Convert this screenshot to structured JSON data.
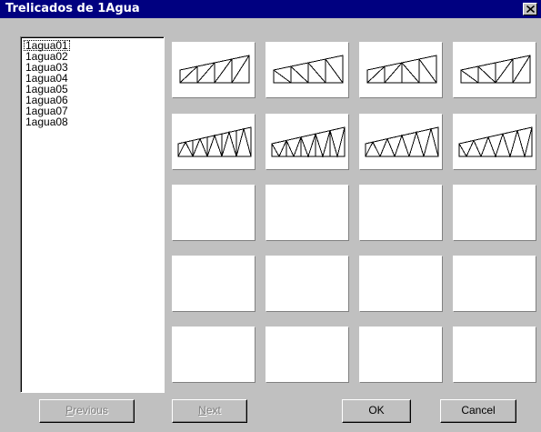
{
  "window": {
    "title": "Trelicados de 1Agua",
    "close_label": "×"
  },
  "list": {
    "items": [
      "1agua01",
      "1agua02",
      "1agua03",
      "1agua04",
      "1agua05",
      "1agua06",
      "1agua07",
      "1agua08"
    ],
    "focused_index": 0
  },
  "thumbnails": [
    {
      "row": 1,
      "col": 1,
      "item": "1agua01",
      "empty": false
    },
    {
      "row": 1,
      "col": 2,
      "item": "1agua02",
      "empty": false
    },
    {
      "row": 1,
      "col": 3,
      "item": "1agua03",
      "empty": false
    },
    {
      "row": 1,
      "col": 4,
      "item": "1agua04",
      "empty": false
    },
    {
      "row": 2,
      "col": 1,
      "item": "1agua05",
      "empty": false
    },
    {
      "row": 2,
      "col": 2,
      "item": "1agua06",
      "empty": false
    },
    {
      "row": 2,
      "col": 3,
      "item": "1agua07",
      "empty": false
    },
    {
      "row": 2,
      "col": 4,
      "item": "1agua08",
      "empty": false
    },
    {
      "row": 3,
      "col": 1,
      "empty": true
    },
    {
      "row": 3,
      "col": 2,
      "empty": true
    },
    {
      "row": 3,
      "col": 3,
      "empty": true
    },
    {
      "row": 3,
      "col": 4,
      "empty": true
    },
    {
      "row": 4,
      "col": 1,
      "empty": true
    },
    {
      "row": 4,
      "col": 2,
      "empty": true
    },
    {
      "row": 4,
      "col": 3,
      "empty": true
    },
    {
      "row": 4,
      "col": 4,
      "empty": true
    },
    {
      "row": 5,
      "col": 1,
      "empty": true
    },
    {
      "row": 5,
      "col": 2,
      "empty": true
    },
    {
      "row": 5,
      "col": 3,
      "empty": true
    },
    {
      "row": 5,
      "col": 4,
      "empty": true
    }
  ],
  "buttons": {
    "previous": {
      "mnemonic": "P",
      "rest": "revious",
      "enabled": false
    },
    "next": {
      "mnemonic": "N",
      "rest": "ext",
      "enabled": false
    },
    "ok": {
      "label": "OK",
      "enabled": true
    },
    "cancel": {
      "label": "Cancel",
      "enabled": true
    }
  },
  "colors": {
    "titlebar": "#000080",
    "face": "#c0c0c0",
    "disabled_text": "#808080"
  }
}
